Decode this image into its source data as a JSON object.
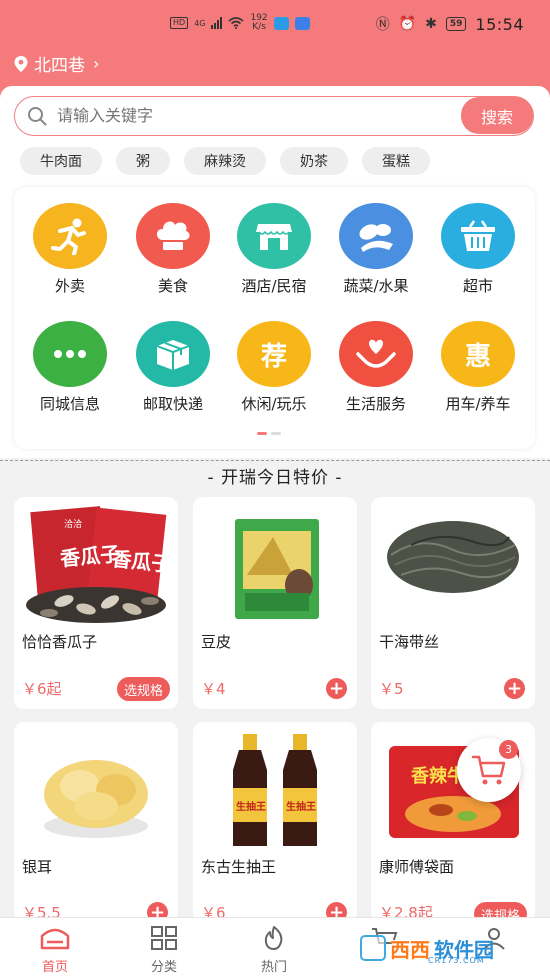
{
  "status_bar": {
    "left_badges": [
      "HD",
      "4G"
    ],
    "speed_value": "192",
    "speed_unit": "K/s",
    "battery": "59",
    "time": "15:54"
  },
  "location": {
    "name": "北四巷"
  },
  "search": {
    "placeholder": "请输入关键字",
    "button_label": "搜索"
  },
  "hot_tags": [
    "牛肉面",
    "粥",
    "麻辣烫",
    "奶茶",
    "蛋糕"
  ],
  "categories": [
    {
      "label": "外卖",
      "icon": "running-man-icon",
      "color": "#f6b51e"
    },
    {
      "label": "美食",
      "icon": "chef-hat-icon",
      "color": "#f05a4f"
    },
    {
      "label": "酒店/民宿",
      "icon": "shop-icon",
      "color": "#2fc0a6"
    },
    {
      "label": "蔬菜/水果",
      "icon": "vegetables-icon",
      "color": "#4a8fe0"
    },
    {
      "label": "超市",
      "icon": "basket-icon",
      "color": "#2aaee0"
    },
    {
      "label": "同城信息",
      "icon": "chat-dots-icon",
      "color": "#3cb043"
    },
    {
      "label": "邮取快递",
      "icon": "package-icon",
      "color": "#23b9a6"
    },
    {
      "label": "休闲/玩乐",
      "icon": "recommend-icon",
      "color": "#f7b718",
      "glyph": "荐"
    },
    {
      "label": "生活服务",
      "icon": "hand-heart-icon",
      "color": "#ef5040"
    },
    {
      "label": "用车/养车",
      "icon": "discount-icon",
      "color": "#f7b718",
      "glyph": "惠"
    }
  ],
  "section_title": "- 开瑞今日特价 -",
  "products": [
    {
      "name": "恰恰香瓜子",
      "price": "￥6起",
      "action": "选规格",
      "image": "sunflower-seeds"
    },
    {
      "name": "豆皮",
      "price": "￥4",
      "action": "+",
      "image": "tofu-skin"
    },
    {
      "name": "干海带丝",
      "price": "￥5",
      "action": "+",
      "image": "dried-kelp"
    },
    {
      "name": "银耳",
      "price": "￥5.5",
      "action": "+",
      "image": "white-fungus"
    },
    {
      "name": "东古生抽王",
      "price": "￥6",
      "action": "+",
      "image": "soy-sauce"
    },
    {
      "name": "康师傅袋面",
      "price": "￥2.8起",
      "action": "选规格",
      "image": "instant-noodles"
    }
  ],
  "product_image_text": {
    "seeds_brand": "洽洽",
    "seeds_label": "香瓜子",
    "soy_label": "生抽王",
    "noodle_label": "香辣牛肉面"
  },
  "cart": {
    "count": "3"
  },
  "bottom_nav": [
    {
      "label": "首页",
      "icon": "home-icon",
      "active": true
    },
    {
      "label": "分类",
      "icon": "grid-icon",
      "active": false
    },
    {
      "label": "热门",
      "icon": "flame-icon",
      "active": false
    },
    {
      "label": "",
      "icon": "cart-icon",
      "active": false
    },
    {
      "label": "",
      "icon": "user-icon",
      "active": false
    }
  ],
  "watermark": {
    "text_a": "西西",
    "text_b": "软件园",
    "sub": "CR173.COM"
  },
  "colors": {
    "primary": "#f47a7b",
    "accent": "#ee5b5b",
    "price": "#f06a6a"
  }
}
